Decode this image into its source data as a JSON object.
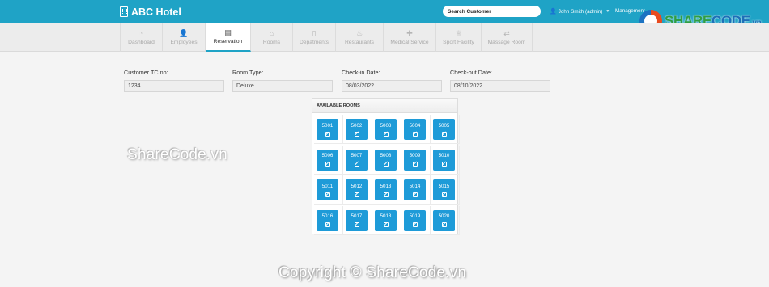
{
  "app": {
    "brand": "ABC Hotel"
  },
  "topbar": {
    "search_placeholder": "Search Customer",
    "user": "John Smith (admin)",
    "management": "Management"
  },
  "logo": {
    "part1": "SHARE",
    "part2": "CODE",
    "suffix": ".vn"
  },
  "tabs": [
    {
      "label": "Dashboard",
      "icon": "dashboard-icon",
      "glyph": "◔",
      "active": false,
      "w": 53
    },
    {
      "label": "Employees",
      "icon": "user-icon",
      "glyph": "👤",
      "active": false,
      "w": 53
    },
    {
      "label": "Reservation",
      "icon": "calendar-icon",
      "glyph": "▤",
      "active": true,
      "w": 56
    },
    {
      "label": "Rooms",
      "icon": "home-icon",
      "glyph": "⌂",
      "active": false,
      "w": 52
    },
    {
      "label": "Depatments",
      "icon": "document-icon",
      "glyph": "▯",
      "active": false,
      "w": 53
    },
    {
      "label": "Restaurants",
      "icon": "food-icon",
      "glyph": "♨",
      "active": false,
      "w": 59
    },
    {
      "label": "Medical Service",
      "icon": "medical-icon",
      "glyph": "✚",
      "active": false,
      "w": 65
    },
    {
      "label": "Sport Facility",
      "icon": "trophy-icon",
      "glyph": "♕",
      "active": false,
      "w": 56
    },
    {
      "label": "Massage Room",
      "icon": "refresh-icon",
      "glyph": "⇄",
      "active": false,
      "w": 63
    }
  ],
  "form": {
    "customer": {
      "label": "Customer TC no:",
      "value": "1234"
    },
    "room_type": {
      "label": "Room Type:",
      "value": "Deluxe"
    },
    "check_in": {
      "label": "Check-in Date:",
      "value": "08/03/2022"
    },
    "check_out": {
      "label": "Check-out Date:",
      "value": "08/10/2022"
    }
  },
  "rooms": {
    "title": "AVAILABLE ROOMS",
    "items": [
      "5001",
      "5002",
      "5003",
      "5004",
      "5005",
      "5006",
      "5007",
      "5008",
      "5009",
      "5010",
      "5011",
      "5012",
      "5013",
      "5014",
      "5015",
      "5016",
      "5017",
      "5018",
      "5019",
      "5020"
    ]
  },
  "watermarks": {
    "middle": "ShareCode.vn",
    "footer": "Copyright © ShareCode.vn"
  }
}
